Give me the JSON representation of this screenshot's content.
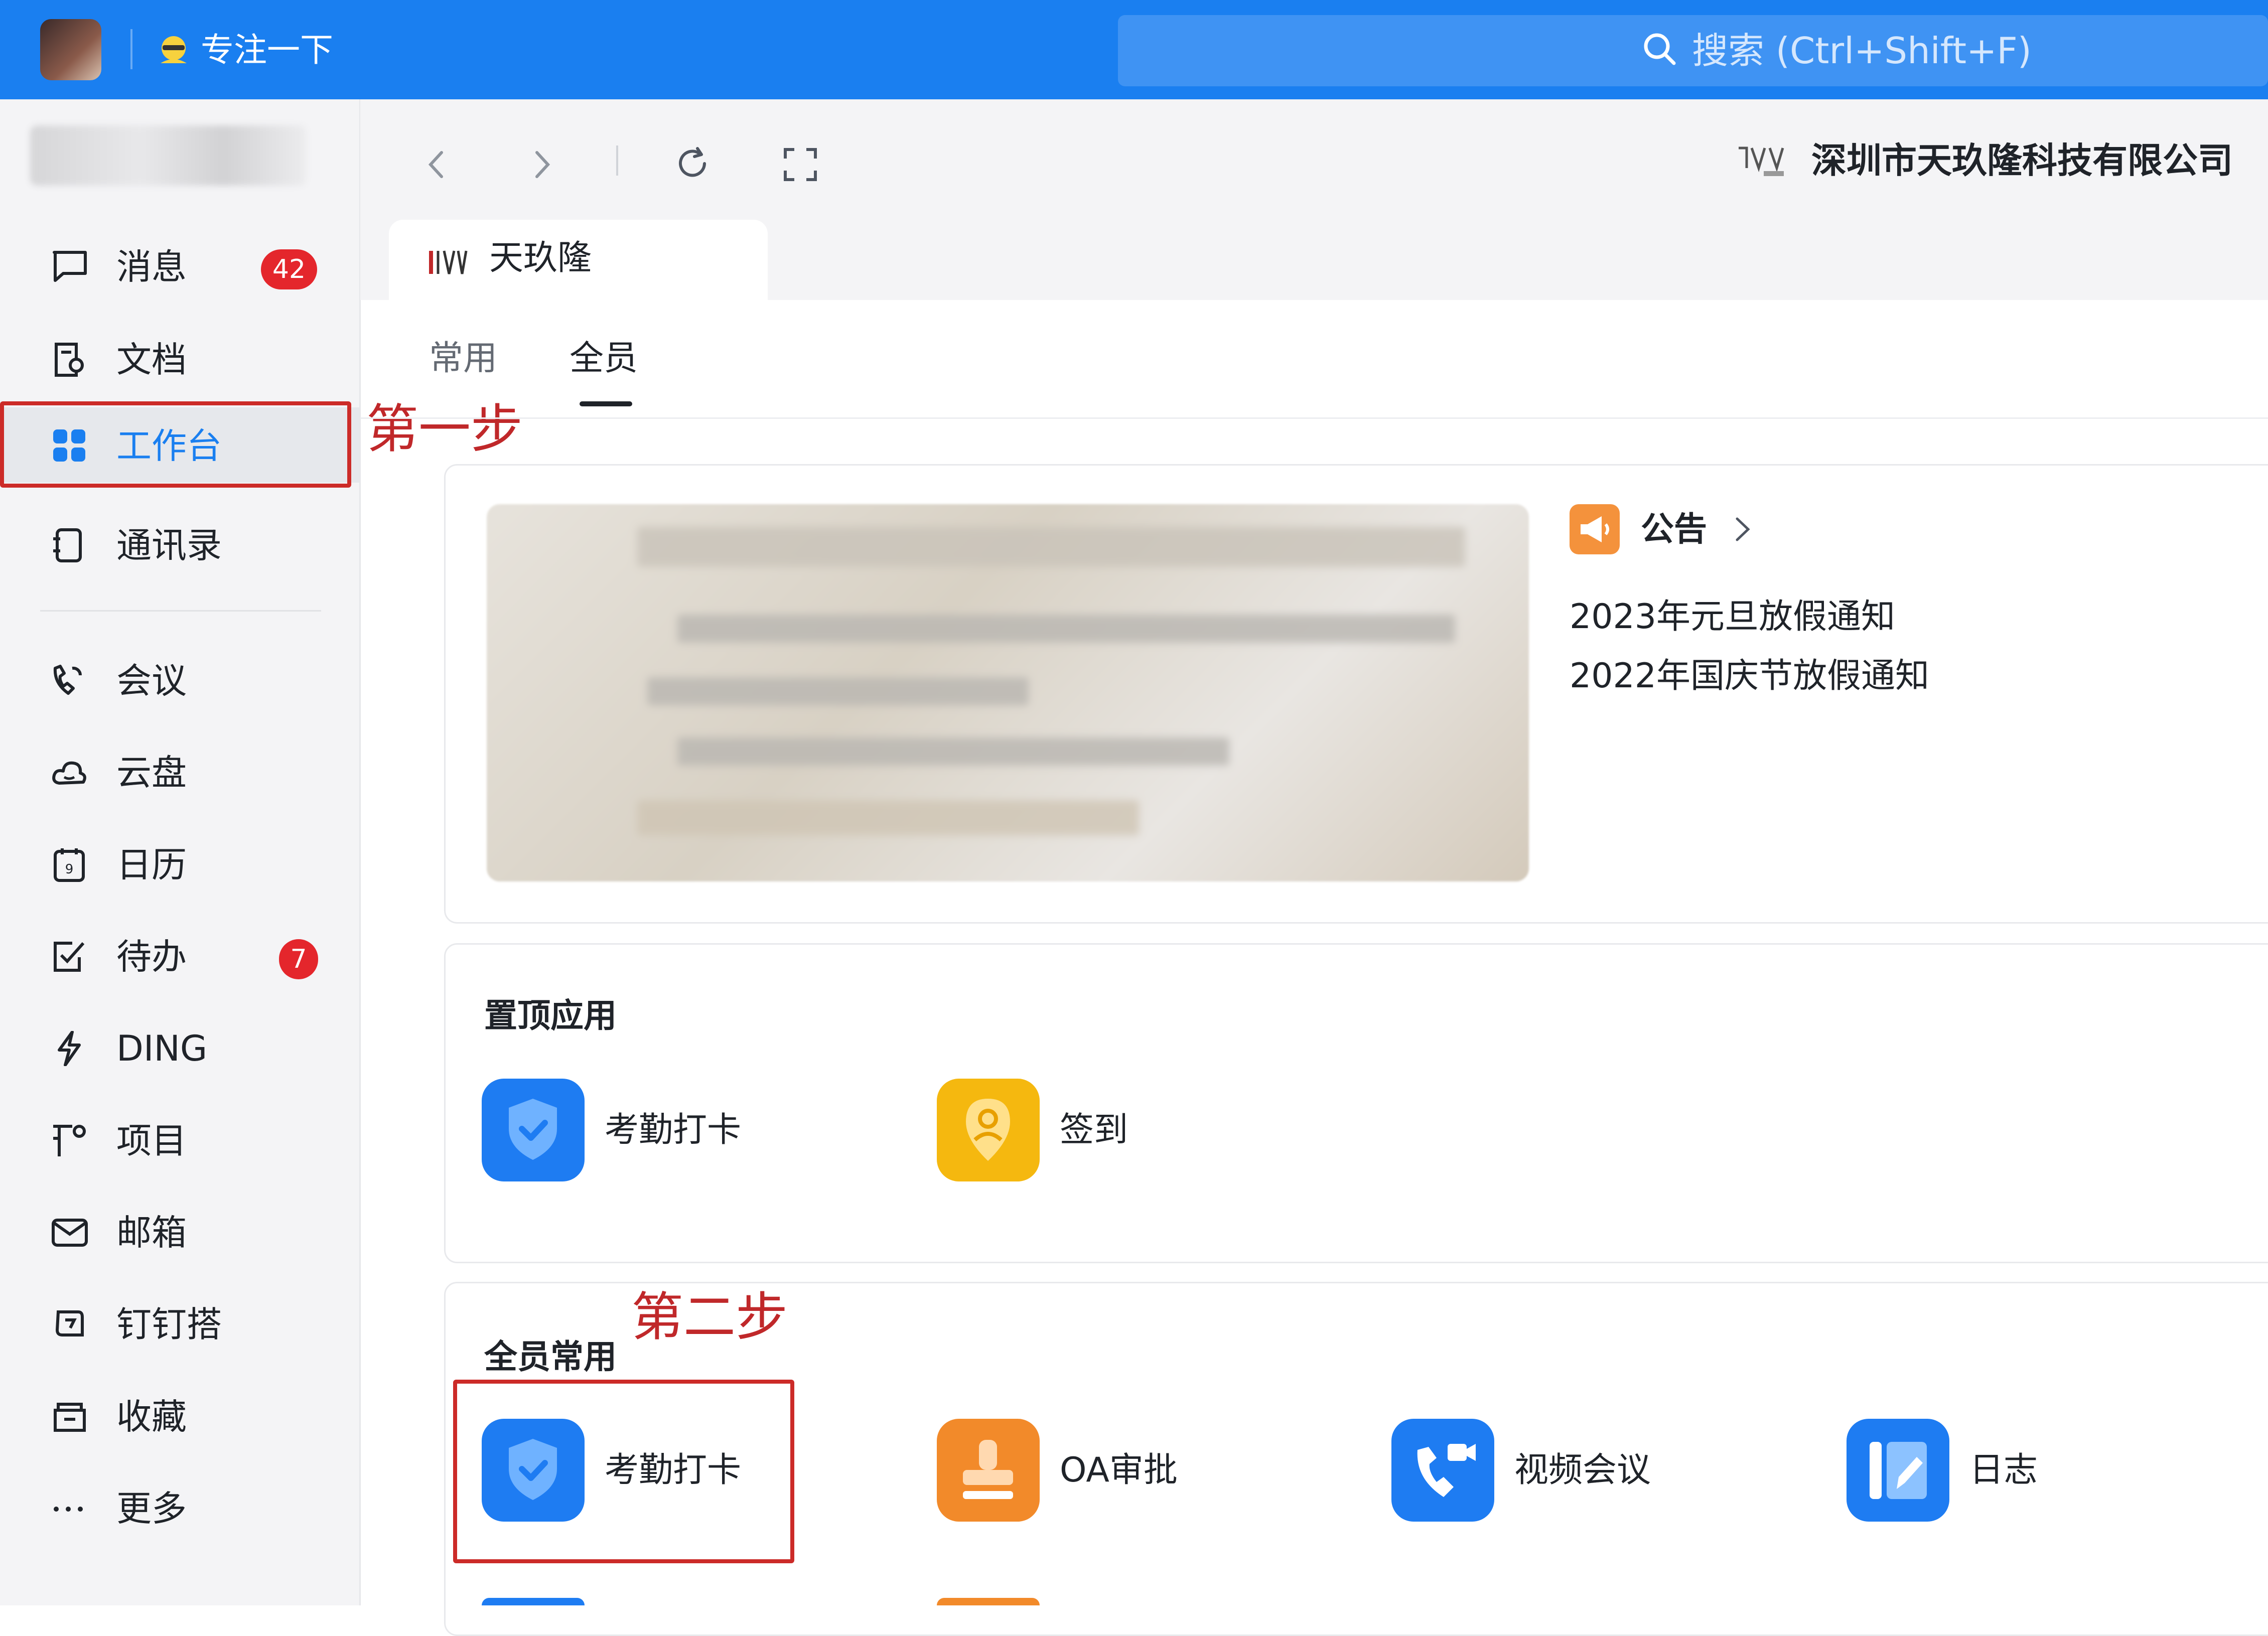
{
  "topbar": {
    "focus_label": "专注一下",
    "search_placeholder": "搜索 (Ctrl+Shift+F)"
  },
  "sidebar": {
    "items": [
      {
        "label": "消息",
        "icon": "message-icon",
        "badge": "42"
      },
      {
        "label": "文档",
        "icon": "document-icon"
      },
      {
        "label": "工作台",
        "icon": "workbench-icon",
        "active": true
      },
      {
        "label": "通讯录",
        "icon": "contacts-icon"
      },
      {
        "label": "会议",
        "icon": "meeting-icon"
      },
      {
        "label": "云盘",
        "icon": "cloud-drive-icon"
      },
      {
        "label": "日历",
        "icon": "calendar-icon"
      },
      {
        "label": "待办",
        "icon": "todo-icon",
        "badge": "7"
      },
      {
        "label": "DING",
        "icon": "ding-icon"
      },
      {
        "label": "项目",
        "icon": "project-icon"
      },
      {
        "label": "邮箱",
        "icon": "mail-icon"
      },
      {
        "label": "钉钉搭",
        "icon": "dingda-icon"
      },
      {
        "label": "收藏",
        "icon": "favorites-icon"
      },
      {
        "label": "更多",
        "icon": "more-icon"
      }
    ]
  },
  "annotations": {
    "step1": "第一步",
    "step2": "第二步"
  },
  "header": {
    "company_name": "深圳市天玖隆科技有限公司",
    "org_tab": "天玖隆"
  },
  "tabs": [
    {
      "label": "常用",
      "active": false
    },
    {
      "label": "全员",
      "active": true
    }
  ],
  "notice": {
    "title": "公告",
    "items": [
      "2023年元旦放假通知",
      "2022年国庆节放假通知"
    ]
  },
  "pinned": {
    "title": "置顶应用",
    "apps": [
      {
        "label": "考勤打卡",
        "icon": "attendance-icon"
      },
      {
        "label": "签到",
        "icon": "checkin-icon"
      }
    ]
  },
  "common": {
    "title": "全员常用",
    "apps": [
      {
        "label": "考勤打卡",
        "icon": "attendance-icon"
      },
      {
        "label": "OA审批",
        "icon": "oa-approval-icon"
      },
      {
        "label": "视频会议",
        "icon": "video-meeting-icon"
      },
      {
        "label": "日志",
        "icon": "log-icon"
      }
    ]
  },
  "colors": {
    "brand": "#1a7ff0",
    "annotation_red": "#cc2b28",
    "badge_red": "#e4262c",
    "orange": "#f4923c",
    "yellow": "#f5b80f"
  }
}
